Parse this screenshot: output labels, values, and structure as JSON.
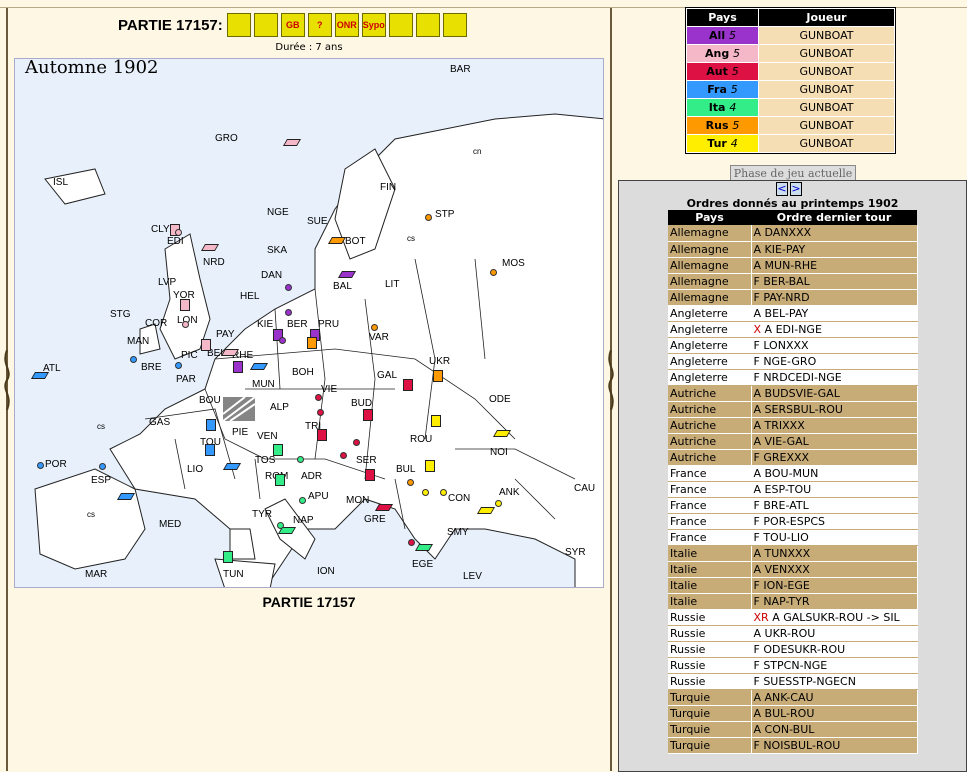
{
  "header": {
    "title": "PARTIE 17157:",
    "toolbar": [
      {
        "icon": "cannon-icon",
        "label": ""
      },
      {
        "icon": "smiley-icon",
        "label": ""
      },
      {
        "icon": "gb-flag-icon",
        "label": "GB"
      },
      {
        "icon": "help-icon",
        "label": "?"
      },
      {
        "icon": "onr-icon",
        "label": "ONR"
      },
      {
        "icon": "sypo-icon",
        "label": "Sypo"
      },
      {
        "icon": "document-icon",
        "label": ""
      },
      {
        "icon": "screen-icon",
        "label": ""
      },
      {
        "icon": "player-icon",
        "label": ""
      }
    ],
    "duration": "Durée : 7 ans"
  },
  "map": {
    "season": "Automne 1902",
    "provinces": [
      "BAR",
      "GRO",
      "ISL",
      "FIN",
      "STP",
      "NGE",
      "SUE",
      "BOT",
      "MOS",
      "CLY",
      "EDI",
      "NRD",
      "SKA",
      "DAN",
      "LIT",
      "YOR",
      "LVP",
      "BAL",
      "HEL",
      "STG",
      "COR",
      "LON",
      "KIE",
      "BER",
      "PRU",
      "MAN",
      "PAY",
      "BEL",
      "VAR",
      "PIC",
      "RHE",
      "UKR",
      "BRE",
      "PAR",
      "MUN",
      "BOH",
      "GAL",
      "ATL",
      "VIE",
      "BOU",
      "ALP",
      "BUD",
      "ODE",
      "GAS",
      "TRI",
      "PIE",
      "VEN",
      "ROU",
      "NOI",
      "TOU",
      "SER",
      "BUL",
      "TOS",
      "LIO",
      "ROM",
      "ADR",
      "POR",
      "ESP",
      "CON",
      "ANK",
      "CAU",
      "APU",
      "MON",
      "TYR",
      "NAP",
      "GRE",
      "MED",
      "SMY",
      "SYR",
      "EGE",
      "MAR",
      "TUN",
      "ION",
      "LEV"
    ],
    "labels": {
      "cs": "cs",
      "cn": "cn"
    }
  },
  "footer_title": "PARTIE 17157",
  "players": {
    "headers": [
      "Pays",
      "Joueur"
    ],
    "rows": [
      {
        "country": "All",
        "count": "5",
        "player": "GUNBOAT",
        "color": "#9933cc"
      },
      {
        "country": "Ang",
        "count": "5",
        "player": "GUNBOAT",
        "color": "#f5b8c8"
      },
      {
        "country": "Aut",
        "count": "5",
        "player": "GUNBOAT",
        "color": "#dd1144"
      },
      {
        "country": "Fra",
        "count": "5",
        "player": "GUNBOAT",
        "color": "#3399ff"
      },
      {
        "country": "Ita",
        "count": "4",
        "player": "GUNBOAT",
        "color": "#33ee88"
      },
      {
        "country": "Rus",
        "count": "5",
        "player": "GUNBOAT",
        "color": "#ff9900"
      },
      {
        "country": "Tur",
        "count": "4",
        "player": "GUNBOAT",
        "color": "#ffee00"
      }
    ]
  },
  "phase_button": "Phase de jeu actuelle",
  "nav": {
    "prev": "<",
    "next": ">"
  },
  "orders": {
    "heading": "Ordres donnés au printemps 1902",
    "headers": [
      "Pays",
      "Ordre dernier tour"
    ],
    "rows": [
      {
        "country": "Allemagne",
        "mark": "",
        "order": "A DANXXX",
        "style": "tan"
      },
      {
        "country": "Allemagne",
        "mark": "",
        "order": "A KIE-PAY",
        "style": "tan"
      },
      {
        "country": "Allemagne",
        "mark": "",
        "order": "A MUN-RHE",
        "style": "tan"
      },
      {
        "country": "Allemagne",
        "mark": "",
        "order": "F BER-BAL",
        "style": "tan"
      },
      {
        "country": "Allemagne",
        "mark": "",
        "order": "F PAY-NRD",
        "style": "tan"
      },
      {
        "country": "Angleterre",
        "mark": "",
        "order": "A BEL-PAY",
        "style": "wht"
      },
      {
        "country": "Angleterre",
        "mark": "X",
        "order": "A EDI-NGE",
        "style": "wht"
      },
      {
        "country": "Angleterre",
        "mark": "",
        "order": "F LONXXX",
        "style": "wht"
      },
      {
        "country": "Angleterre",
        "mark": "",
        "order": "F NGE-GRO",
        "style": "wht"
      },
      {
        "country": "Angleterre",
        "mark": "",
        "order": "F NRDCEDI-NGE",
        "style": "wht"
      },
      {
        "country": "Autriche",
        "mark": "",
        "order": "A BUDSVIE-GAL",
        "style": "tan"
      },
      {
        "country": "Autriche",
        "mark": "",
        "order": "A SERSBUL-ROU",
        "style": "tan"
      },
      {
        "country": "Autriche",
        "mark": "",
        "order": "A TRIXXX",
        "style": "tan"
      },
      {
        "country": "Autriche",
        "mark": "",
        "order": "A VIE-GAL",
        "style": "tan"
      },
      {
        "country": "Autriche",
        "mark": "",
        "order": "F GREXXX",
        "style": "tan"
      },
      {
        "country": "France",
        "mark": "",
        "order": "A BOU-MUN",
        "style": "wht"
      },
      {
        "country": "France",
        "mark": "",
        "order": "A ESP-TOU",
        "style": "wht"
      },
      {
        "country": "France",
        "mark": "",
        "order": "F BRE-ATL",
        "style": "wht"
      },
      {
        "country": "France",
        "mark": "",
        "order": "F POR-ESPCS",
        "style": "wht"
      },
      {
        "country": "France",
        "mark": "",
        "order": "F TOU-LIO",
        "style": "wht"
      },
      {
        "country": "Italie",
        "mark": "",
        "order": "A TUNXXX",
        "style": "tan"
      },
      {
        "country": "Italie",
        "mark": "",
        "order": "A VENXXX",
        "style": "tan"
      },
      {
        "country": "Italie",
        "mark": "",
        "order": "F ION-EGE",
        "style": "tan"
      },
      {
        "country": "Italie",
        "mark": "",
        "order": "F NAP-TYR",
        "style": "tan"
      },
      {
        "country": "Russie",
        "mark": "XR",
        "order": "A GALSUKR-ROU -> SIL",
        "style": "wht"
      },
      {
        "country": "Russie",
        "mark": "",
        "order": "A UKR-ROU",
        "style": "wht"
      },
      {
        "country": "Russie",
        "mark": "",
        "order": "F ODESUKR-ROU",
        "style": "wht"
      },
      {
        "country": "Russie",
        "mark": "",
        "order": "F STPCN-NGE",
        "style": "wht"
      },
      {
        "country": "Russie",
        "mark": "",
        "order": "F SUESSTP-NGECN",
        "style": "wht"
      },
      {
        "country": "Turquie",
        "mark": "",
        "order": "A ANK-CAU",
        "style": "tan"
      },
      {
        "country": "Turquie",
        "mark": "",
        "order": "A BUL-ROU",
        "style": "tan"
      },
      {
        "country": "Turquie",
        "mark": "",
        "order": "A CON-BUL",
        "style": "tan"
      },
      {
        "country": "Turquie",
        "mark": "",
        "order": "F NOISBUL-ROU",
        "style": "tan"
      }
    ]
  }
}
